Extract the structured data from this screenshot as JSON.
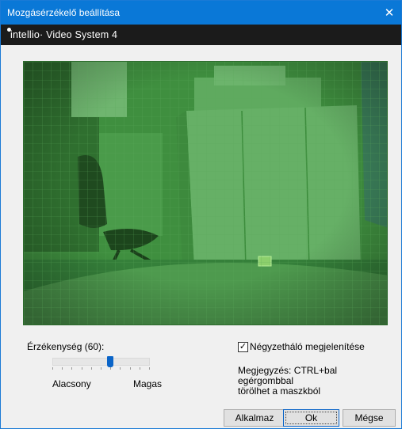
{
  "window": {
    "title": "Mozgásérzékelő beállítása",
    "close_glyph": "✕",
    "title_bar_color": "#0a78d7"
  },
  "brand": {
    "text": "intellio· Video System 4",
    "bar_color": "#1b1b1b"
  },
  "video": {
    "overlay_color": "#3b8f3b",
    "selected_cell_present": true
  },
  "sensitivity": {
    "label": "Érzékenység (60):",
    "value": 60,
    "low_label": "Alacsony",
    "high_label": "Magas"
  },
  "grid_option": {
    "label": "Négyzetháló megjelenítése",
    "checked": true,
    "check_glyph": "✓"
  },
  "note": {
    "text": "Megjegyzés: CTRL+bal egérgombbal\ntörölhet a maszkból"
  },
  "buttons": {
    "apply": "Alkalmaz",
    "ok": "Ok",
    "cancel": "Mégse"
  },
  "icons": {
    "close": "close-icon",
    "check": "checkmark-icon"
  }
}
